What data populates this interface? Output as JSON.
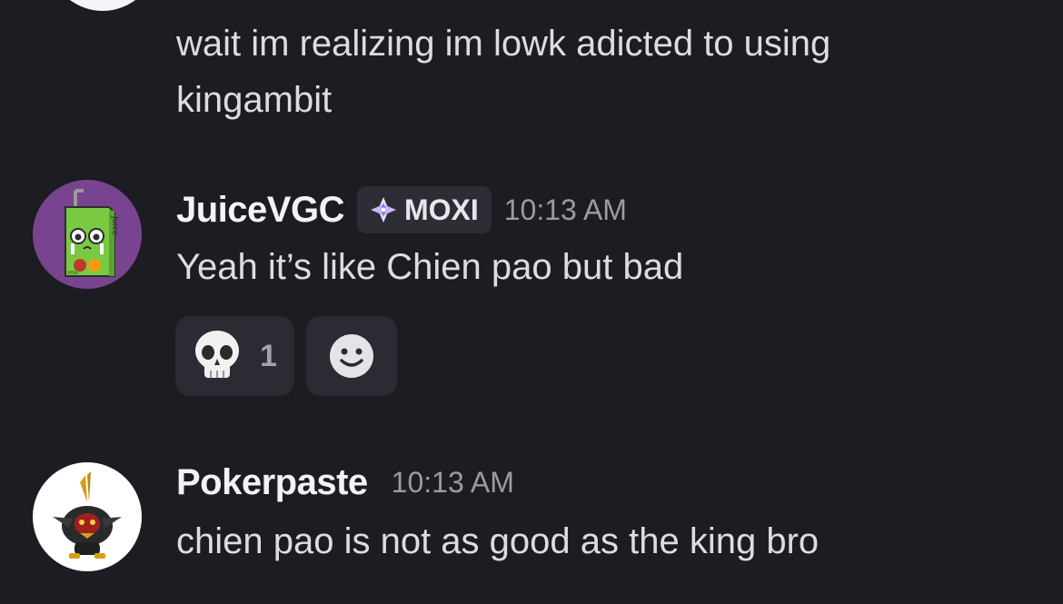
{
  "messages": [
    {
      "id": "cont",
      "lines": [
        "wait im realizing im lowk adicted to using",
        "kingambit"
      ]
    },
    {
      "id": "juice",
      "author": "JuiceVGC",
      "role_tag": "MOXI",
      "timestamp": "10:13 AM",
      "text": "Yeah it’s like Chien pao but bad",
      "avatar_text": "Juice",
      "reactions": [
        {
          "emoji": "skull-emoji",
          "count": "1"
        }
      ]
    },
    {
      "id": "poker",
      "author": "Pokerpaste",
      "timestamp": "10:13 AM",
      "text": "chien pao is not as good as the king bro"
    }
  ],
  "icons": {
    "role": "diamond-sparkle-icon",
    "add_reaction": "smiley-face-icon"
  },
  "colors": {
    "background": "#1c1c22",
    "avatar_juice_bg": "#79448f",
    "role_tag_bg": "#2c2d35",
    "reaction_bg": "#2a2b33"
  }
}
